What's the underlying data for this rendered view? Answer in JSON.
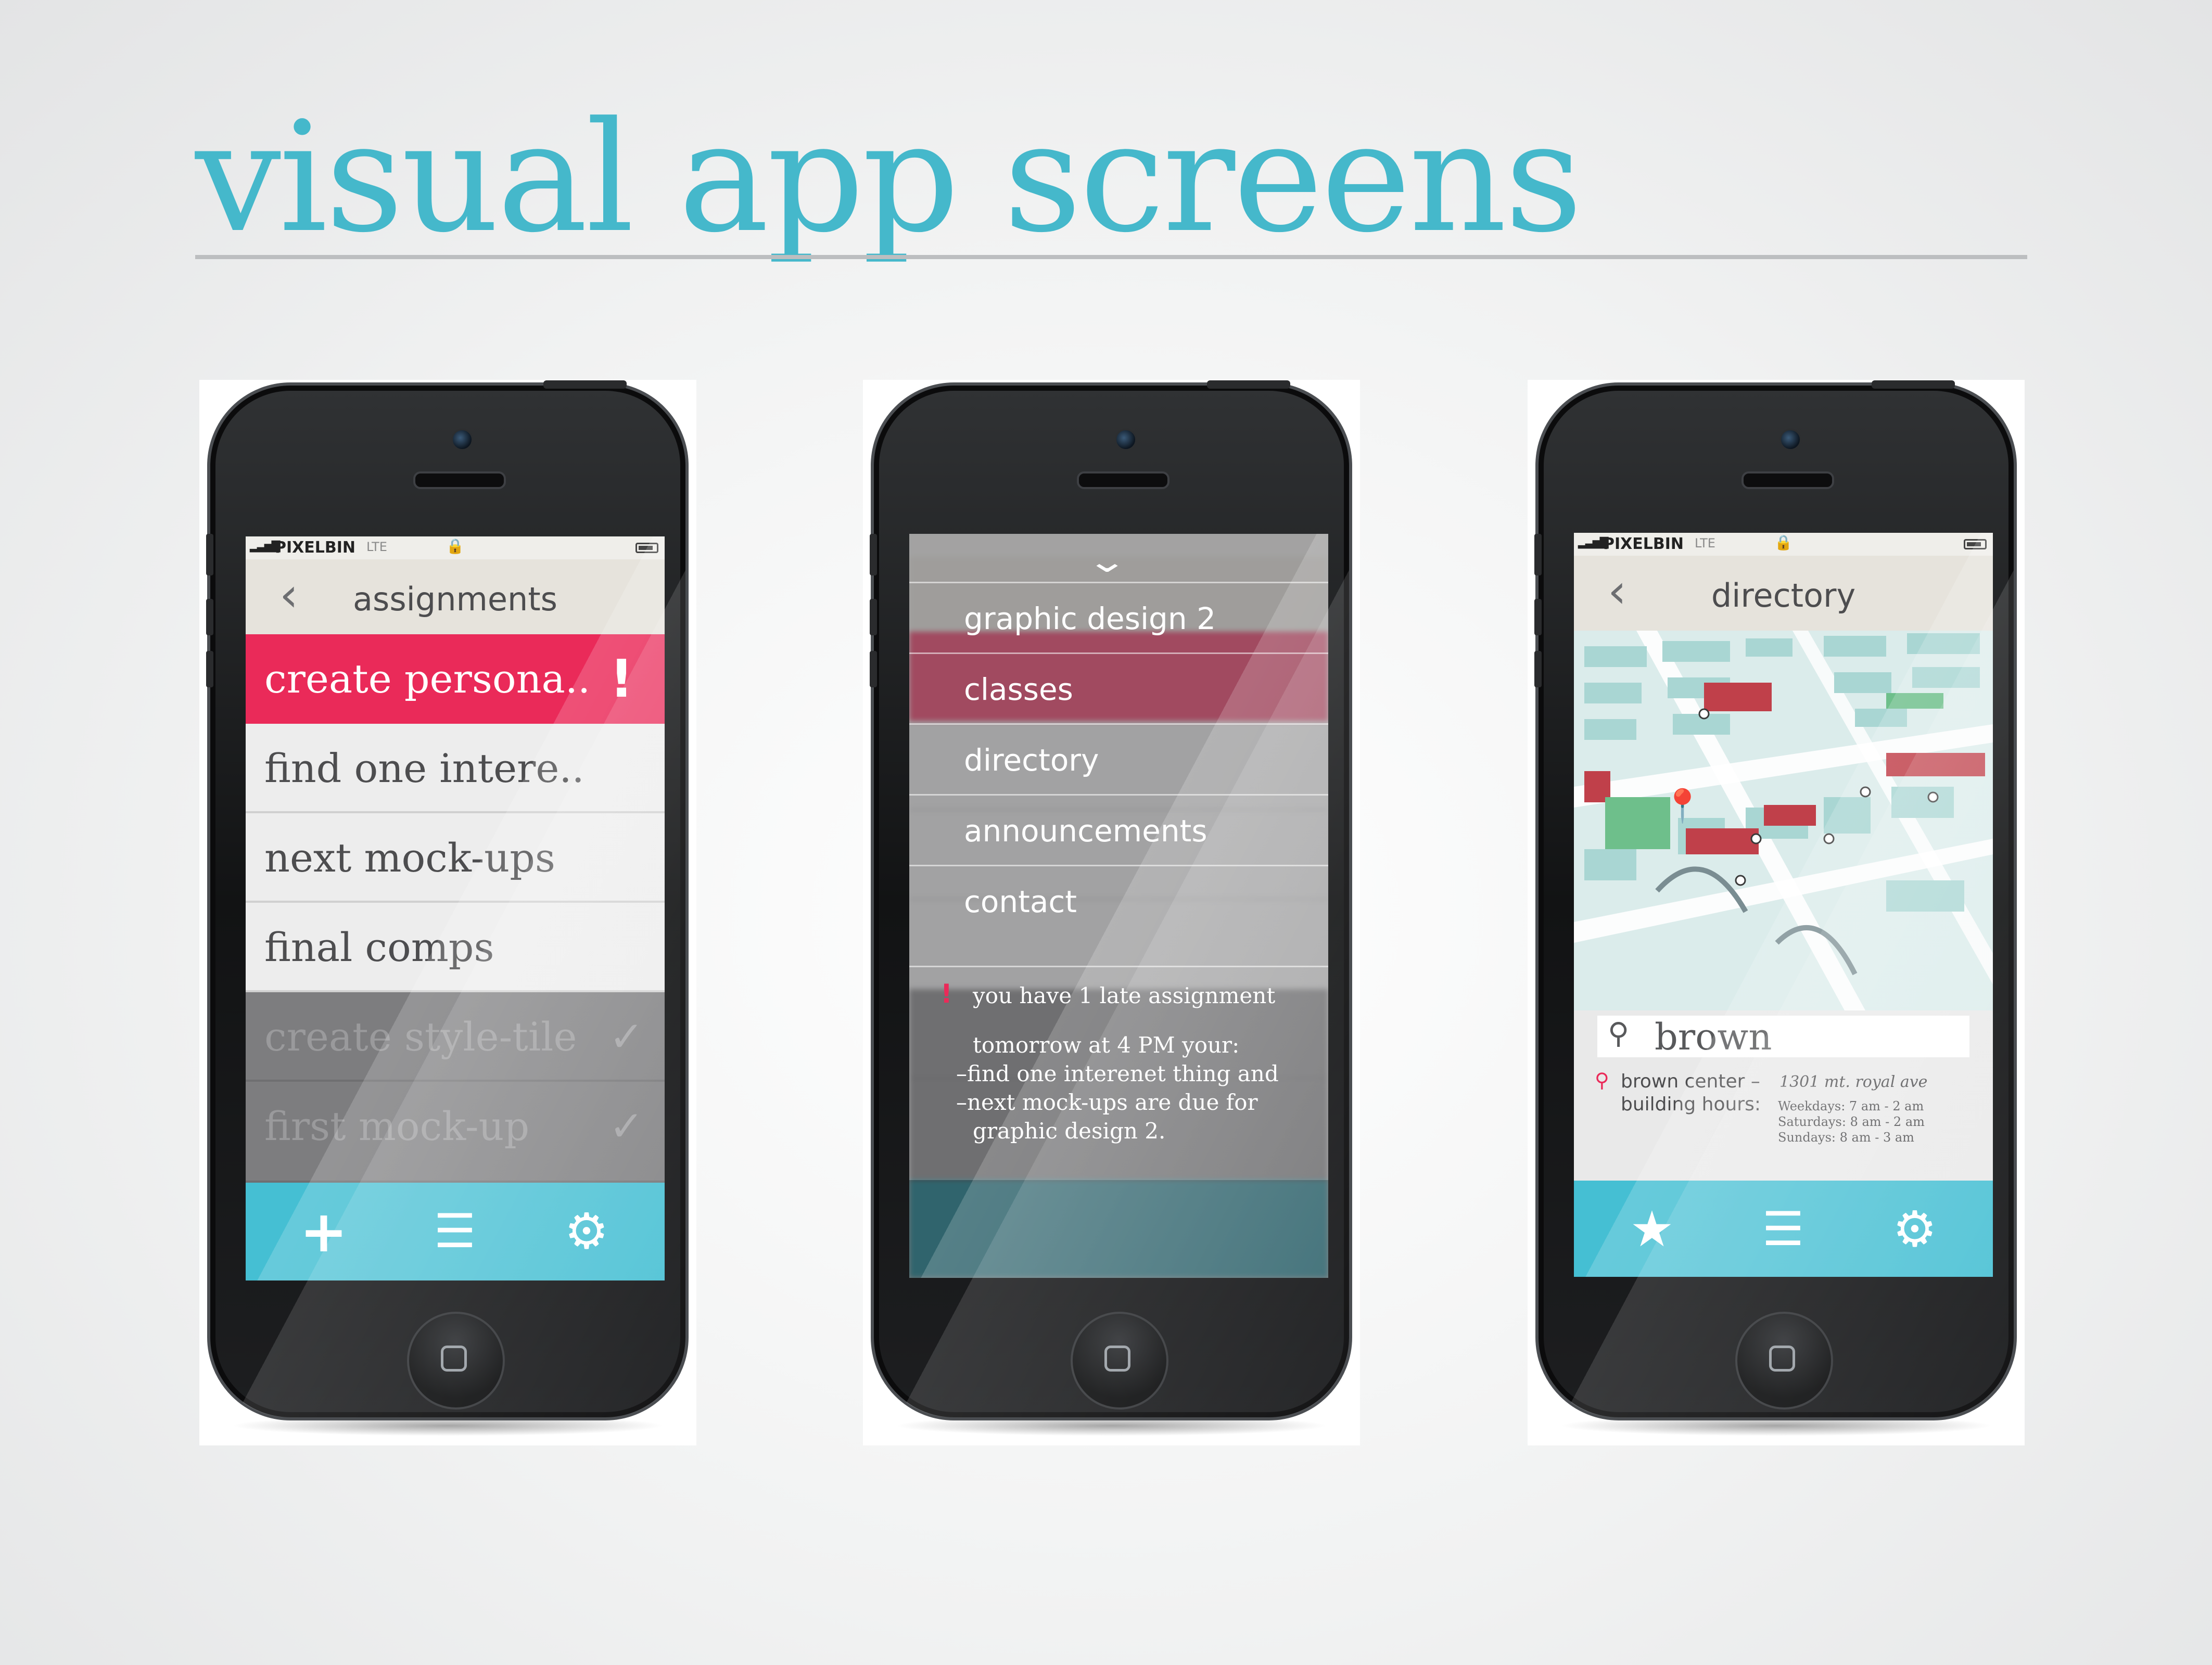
{
  "page_title": "visual app screens",
  "colors": {
    "accent": "#45b8cb",
    "alert": "#ea2a59",
    "tab_bar": "#45bfd3"
  },
  "screen1": {
    "status": {
      "carrier": "PIXELBIN",
      "network": "LTE"
    },
    "nav_title": "assignments",
    "items": [
      {
        "label": "create persona..",
        "state": "urgent",
        "mark": "!"
      },
      {
        "label": "find one intere..",
        "state": "open"
      },
      {
        "label": "next mock-ups",
        "state": "open"
      },
      {
        "label": "final comps",
        "state": "open"
      },
      {
        "label": "create style-tile",
        "state": "done"
      },
      {
        "label": "first mock-up",
        "state": "done"
      }
    ],
    "tabs": [
      "plus-icon",
      "list-icon",
      "gear-icon"
    ]
  },
  "screen2": {
    "menu": [
      "graphic design 2",
      "classes",
      "directory",
      "announcements",
      "contact"
    ],
    "notice": {
      "mark": "!",
      "late": "you have 1 late assignment",
      "lines": [
        "tomorrow at 4 PM your:",
        "–find one interenet thing and",
        "–next mock-ups are due for",
        "graphic design 2."
      ]
    }
  },
  "screen3": {
    "status": {
      "carrier": "PIXELBIN",
      "network": "LTE"
    },
    "nav_title": "directory",
    "search_value": "brown",
    "result": {
      "name": "brown center –",
      "address": "1301 mt. royal ave",
      "hours_label": "building hours:",
      "hours": [
        "Weekdays: 7 am - 2 am",
        "Saturdays: 8 am - 2 am",
        "Sundays: 8 am - 3 am"
      ]
    },
    "tabs": [
      "star-icon",
      "list-icon",
      "gear-icon"
    ]
  }
}
